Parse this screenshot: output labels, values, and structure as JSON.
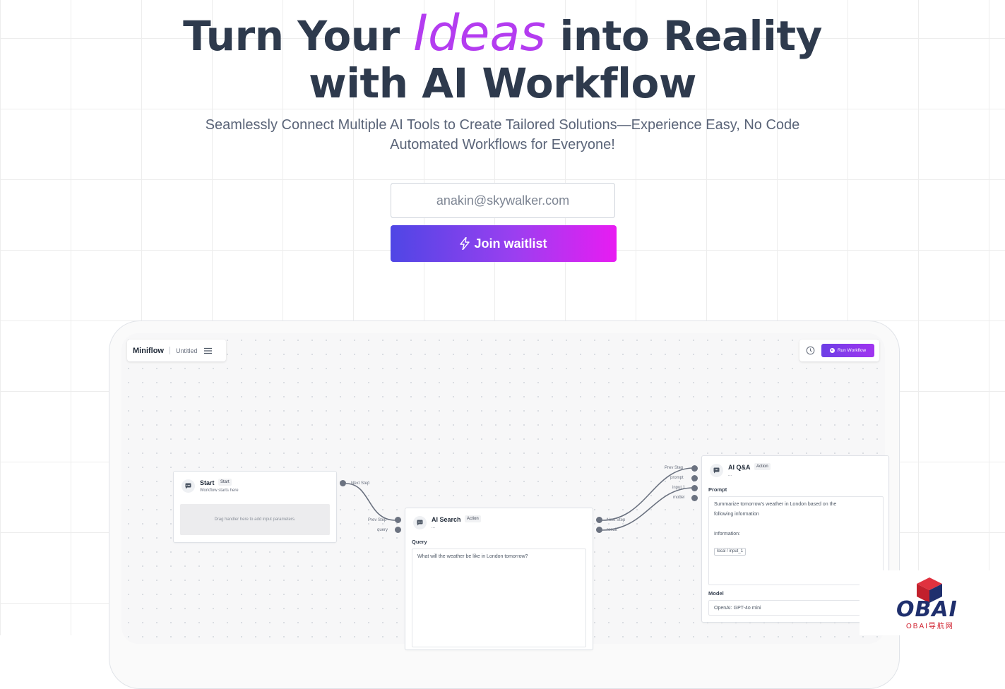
{
  "hero": {
    "title_before": "Turn Your ",
    "title_accent": "Ideas",
    "title_after": " into Reality",
    "title_line2": "with AI Workflow",
    "subtitle": "Seamlessly Connect Multiple AI Tools to Create Tailored Solutions—Experience Easy, No Code Automated Workflows for Everyone!"
  },
  "form": {
    "email_placeholder": "anakin@skywalker.com",
    "join_label": "Join waitlist"
  },
  "app": {
    "brand": "Miniflow",
    "file_name": "Untitled",
    "run_label": "Run Workflow",
    "nodes": {
      "start": {
        "title": "Start",
        "tag": "Start",
        "subtitle": "Workflow starts here",
        "drop_text": "Drag handler here to add input parameters.",
        "port_next": "Next Step"
      },
      "search": {
        "title": "AI Search",
        "tag": "Action",
        "subtitle": "...",
        "query_label": "Query",
        "query_text": "What will the weather be like in London tomorrow?",
        "port_prev": "Prev Step",
        "port_query": "query",
        "port_next": "Next Step",
        "port_result": "result"
      },
      "qa": {
        "title": "AI Q&A",
        "tag": "Action",
        "subtitle": "...",
        "prompt_label": "Prompt",
        "prompt_line1": "Summarize tomorrow's weather in London based on the",
        "prompt_line2": "following information",
        "prompt_line3": "Information:",
        "prompt_chip": "local / input_1",
        "model_label": "Model",
        "model_value": "OpenAI: GPT-4o mini",
        "port_prev": "Prev Step",
        "port_prompt": "prompt",
        "port_input": "input 1",
        "port_model": "model"
      }
    }
  },
  "watermark": {
    "logo_text": "OBAI",
    "logo_sub": "OBAI导航网"
  },
  "colors": {
    "accent_purple": "#b43cf0",
    "button_start": "#4f46e5",
    "button_end": "#e81cf2",
    "heading": "#2e3a4d"
  }
}
